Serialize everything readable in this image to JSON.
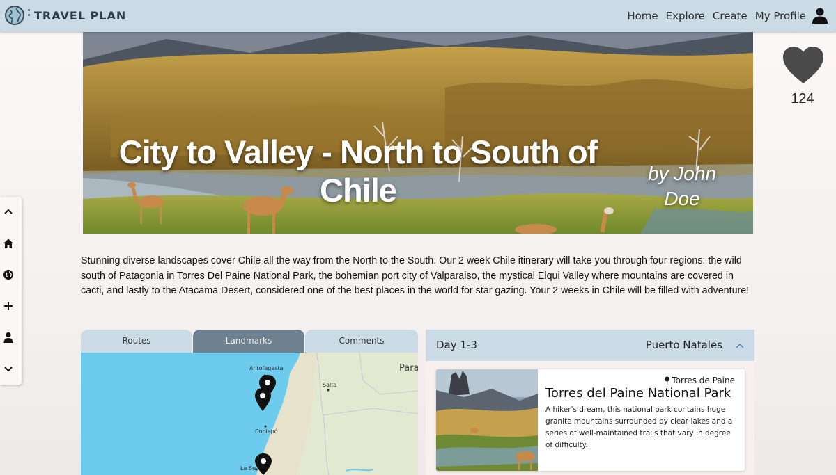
{
  "app": {
    "title": "TRAVEL PLAN",
    "logo_icon": "globe-icon"
  },
  "nav": {
    "links": [
      "Home",
      "Explore",
      "Create",
      "My Profile"
    ],
    "profile_icon": "user-icon"
  },
  "hero": {
    "title": "City to Valley - North to South of Chile",
    "author": "by John Doe"
  },
  "likes": {
    "icon": "heart-icon",
    "count": "124"
  },
  "sidebar": {
    "icons": [
      "chevron-up-icon",
      "home-icon",
      "globe-icon",
      "plus-icon",
      "user-icon",
      "chevron-down-icon"
    ]
  },
  "description": "Stunning diverse landscapes cover Chile all the way from the North to the South. Our 2 week Chile itinerary will take you through four regions: the wild south of Patagonia in Torres Del Paine National Park, the bohemian port city of Valparaiso, the mystical Elqui Valley where mountains are covered in cacti, and lastly to the Atacama Desert, considered one of the best places in the world for star gazing. Your 2 weeks in Chile will be filled with adventure!",
  "tabs": {
    "items": [
      "Routes",
      "Landmarks",
      "Comments"
    ],
    "active": "Landmarks"
  },
  "map": {
    "labels": {
      "antofagasta": "Antofagasta",
      "salta": "Salta",
      "paraguay": "Para",
      "copiapo": "Copiapó",
      "laserena": "La Se"
    }
  },
  "day": {
    "label": "Day 1-3",
    "place": "Puerto Natales",
    "card": {
      "location": "Torres de Paine",
      "title": "Torres del Paine National Park",
      "description": "A hiker's dream, this national park contains huge granite mountains surrounded by clear lakes and a series of well-maintained trails that vary in degree of difficulty."
    }
  },
  "colors": {
    "navbar": "#cbdbe6",
    "tab_active": "#6e7f8d",
    "heart": "#4a4a4a",
    "map_sea": "#6dcbee"
  }
}
